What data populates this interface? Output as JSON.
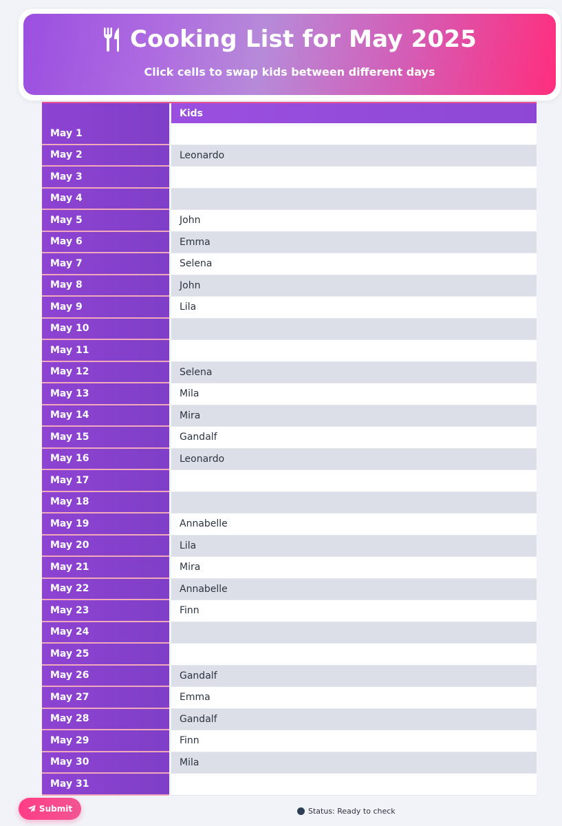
{
  "header": {
    "title": "Cooking List for May 2025",
    "subtitle": "Click cells to swap kids between different days",
    "icon": "fork-knife-icon"
  },
  "table": {
    "columns": [
      "",
      "Kids"
    ],
    "rows": [
      {
        "date": "May 1",
        "kid": ""
      },
      {
        "date": "May 2",
        "kid": "Leonardo"
      },
      {
        "date": "May 3",
        "kid": ""
      },
      {
        "date": "May 4",
        "kid": ""
      },
      {
        "date": "May 5",
        "kid": "John"
      },
      {
        "date": "May 6",
        "kid": "Emma"
      },
      {
        "date": "May 7",
        "kid": "Selena"
      },
      {
        "date": "May 8",
        "kid": "John"
      },
      {
        "date": "May 9",
        "kid": "Lila"
      },
      {
        "date": "May 10",
        "kid": ""
      },
      {
        "date": "May 11",
        "kid": ""
      },
      {
        "date": "May 12",
        "kid": "Selena"
      },
      {
        "date": "May 13",
        "kid": "Mila"
      },
      {
        "date": "May 14",
        "kid": "Mira"
      },
      {
        "date": "May 15",
        "kid": "Gandalf"
      },
      {
        "date": "May 16",
        "kid": "Leonardo"
      },
      {
        "date": "May 17",
        "kid": ""
      },
      {
        "date": "May 18",
        "kid": ""
      },
      {
        "date": "May 19",
        "kid": "Annabelle"
      },
      {
        "date": "May 20",
        "kid": "Lila"
      },
      {
        "date": "May 21",
        "kid": "Mira"
      },
      {
        "date": "May 22",
        "kid": "Annabelle"
      },
      {
        "date": "May 23",
        "kid": "Finn"
      },
      {
        "date": "May 24",
        "kid": ""
      },
      {
        "date": "May 25",
        "kid": ""
      },
      {
        "date": "May 26",
        "kid": "Gandalf"
      },
      {
        "date": "May 27",
        "kid": "Emma"
      },
      {
        "date": "May 28",
        "kid": "Gandalf"
      },
      {
        "date": "May 29",
        "kid": "Finn"
      },
      {
        "date": "May 30",
        "kid": "Mila"
      },
      {
        "date": "May 31",
        "kid": ""
      }
    ]
  },
  "footer": {
    "submit_label": "Submit",
    "submit_icon": "paper-plane-icon",
    "status_text": "Status: Ready to check"
  },
  "colors": {
    "accent_purple": "#9b4fe0",
    "accent_pink": "#ff2e7e",
    "status_dot": "#2d3e55"
  }
}
